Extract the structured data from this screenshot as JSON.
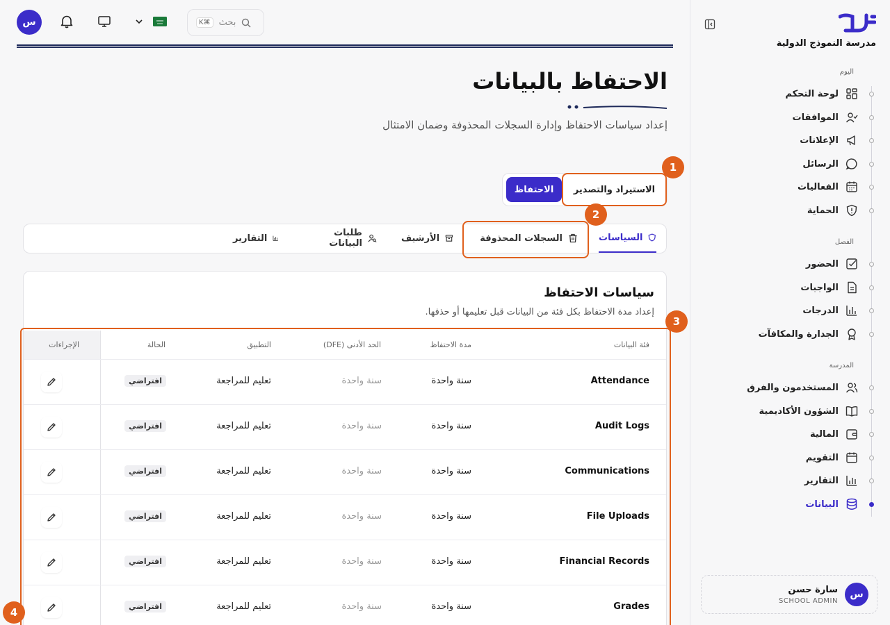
{
  "sidebar": {
    "school_name": "مدرسة النموذج الدولية",
    "groups": [
      {
        "label": "اليوم",
        "items": [
          {
            "label": "لوحة التحكم",
            "icon": "dashboard-icon"
          },
          {
            "label": "الموافقات",
            "icon": "user-check-icon"
          },
          {
            "label": "الإعلانات",
            "icon": "megaphone-icon"
          },
          {
            "label": "الرسائل",
            "icon": "message-icon"
          },
          {
            "label": "الفعاليات",
            "icon": "calendar-icon"
          },
          {
            "label": "الحماية",
            "icon": "shield-alert-icon"
          }
        ]
      },
      {
        "label": "الفصل",
        "items": [
          {
            "label": "الحضور",
            "icon": "checkbox-icon"
          },
          {
            "label": "الواجبات",
            "icon": "document-icon"
          },
          {
            "label": "الدرجات",
            "icon": "bar-chart-icon"
          },
          {
            "label": "الجدارة والمكافآت",
            "icon": "award-icon"
          }
        ]
      },
      {
        "label": "المدرسة",
        "items": [
          {
            "label": "المستخدمون والفرق",
            "icon": "users-icon"
          },
          {
            "label": "الشؤون الأكاديمية",
            "icon": "book-icon"
          },
          {
            "label": "المالية",
            "icon": "wallet-icon"
          },
          {
            "label": "التقويم",
            "icon": "calendar-icon"
          },
          {
            "label": "التقارير",
            "icon": "report-icon"
          },
          {
            "label": "البيانات",
            "icon": "database-icon"
          }
        ]
      }
    ],
    "user": {
      "name": "سارة حسن",
      "role": "SCHOOL ADMIN",
      "avatar_letter": "س"
    }
  },
  "topbar": {
    "avatar_letter": "س",
    "search_placeholder": "بحث",
    "search_shortcut": "K⌘"
  },
  "header": {
    "title": "الاحتفاظ بالبيانات",
    "subtitle": "إعداد سياسات الاحتفاظ وإدارة السجلات المحذوفة وضمان الامتثال"
  },
  "tabs": {
    "active": "الاحتفاظ",
    "other": "الاستيراد والتصدير"
  },
  "subtabs": [
    {
      "label": "السياسات",
      "icon": "shield-icon",
      "active": true
    },
    {
      "label": "السجلات المحذوفة",
      "icon": "trash-icon",
      "active": false
    },
    {
      "label": "الأرشيف",
      "icon": "archive-icon",
      "active": false
    },
    {
      "label": "طلبات البيانات",
      "icon": "user-search-icon",
      "active": false
    },
    {
      "label": "التقارير",
      "icon": "report-icon",
      "active": false
    }
  ],
  "card": {
    "title": "سياسات الاحتفاظ",
    "subtitle": "إعداد مدة الاحتفاظ بكل فئة من البيانات قبل تعليمها أو حذفها."
  },
  "table": {
    "headers": {
      "category": "فئة البيانات",
      "retention": "مدة الاحتفاظ",
      "min": "الحد الأدنى (DFE)",
      "application": "التطبيق",
      "status": "الحالة",
      "actions": "الإجراءات"
    },
    "rows": [
      {
        "category": "Attendance",
        "retention": "سنة واحدة",
        "min": "سنة واحدة",
        "application": "تعليم للمراجعة",
        "status": "افتراضي"
      },
      {
        "category": "Audit Logs",
        "retention": "سنة واحدة",
        "min": "سنة واحدة",
        "application": "تعليم للمراجعة",
        "status": "افتراضي"
      },
      {
        "category": "Communications",
        "retention": "سنة واحدة",
        "min": "سنة واحدة",
        "application": "تعليم للمراجعة",
        "status": "افتراضي"
      },
      {
        "category": "File Uploads",
        "retention": "سنة واحدة",
        "min": "سنة واحدة",
        "application": "تعليم للمراجعة",
        "status": "افتراضي"
      },
      {
        "category": "Financial Records",
        "retention": "سنة واحدة",
        "min": "سنة واحدة",
        "application": "تعليم للمراجعة",
        "status": "افتراضي"
      },
      {
        "category": "Grades",
        "retention": "سنة واحدة",
        "min": "سنة واحدة",
        "application": "تعليم للمراجعة",
        "status": "افتراضي"
      }
    ]
  },
  "callouts": [
    "1",
    "2",
    "3",
    "4"
  ],
  "colors": {
    "accent": "#3b2cc9",
    "highlight": "#e0601d",
    "navy": "#1e2a5a"
  }
}
